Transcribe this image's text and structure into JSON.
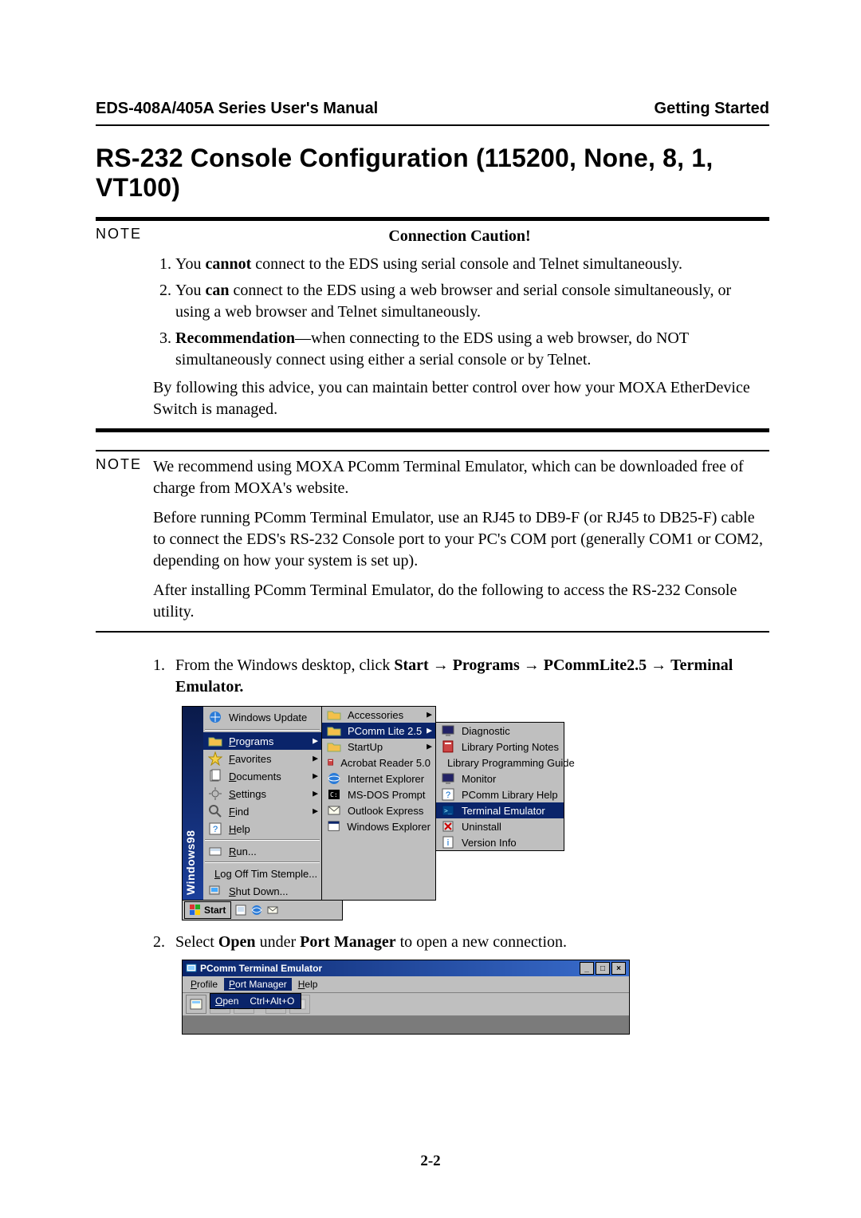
{
  "header": {
    "manual": "EDS-408A/405A Series User's Manual",
    "section": "Getting Started"
  },
  "title": "RS-232 Console Configuration (115200, None, 8, 1, VT100)",
  "note1": {
    "label": "NOTE",
    "caution_title": "Connection Caution!",
    "items": [
      {
        "pre": "You ",
        "b1": "cannot",
        "post": " connect to the EDS using serial console and Telnet simultaneously."
      },
      {
        "pre": "You ",
        "b1": "can",
        "post": " connect to the EDS using a web browser and serial console simultaneously, or using a web browser and Telnet simultaneously."
      },
      {
        "b1": "Recommendation",
        "dash": "—",
        "post": "when connecting to the EDS using a web browser, do NOT simultaneously connect using either a serial console or by Telnet."
      }
    ],
    "tail": "By following this advice, you can maintain better control over how your MOXA EtherDevice Switch is managed."
  },
  "note2": {
    "label": "NOTE",
    "paras": [
      "We recommend using MOXA PComm Terminal Emulator, which can be downloaded free of charge from MOXA's website.",
      "Before running PComm Terminal Emulator, use an RJ45 to DB9-F (or RJ45 to DB25-F) cable to connect the EDS's RS-232 Console port to your PC's COM port (generally COM1 or COM2, depending on how your system is set up).",
      "After installing PComm Terminal Emulator, do the following to access the RS-232 Console utility."
    ]
  },
  "step1": {
    "num": "1.",
    "pre": "From the Windows desktop, click ",
    "b1": "Start",
    "a1": " → ",
    "b2": "Programs",
    "a2": " → ",
    "b3": "PCommLite2.5",
    "a3": " → ",
    "b4": "Terminal Emulator."
  },
  "startmenu": {
    "brand_a": "Windows",
    "brand_b": "98",
    "items": [
      {
        "key": "wu",
        "label": "Windows Update",
        "arrow": false,
        "sel": false,
        "tall": true
      },
      {
        "key": "sep1",
        "label": "",
        "sep": true
      },
      {
        "key": "pr",
        "label": "Programs",
        "ul": "P",
        "arrow": true,
        "sel": true
      },
      {
        "key": "fa",
        "label": "Favorites",
        "ul": "F",
        "arrow": true,
        "sel": false
      },
      {
        "key": "do",
        "label": "Documents",
        "ul": "D",
        "arrow": true,
        "sel": false
      },
      {
        "key": "se",
        "label": "Settings",
        "ul": "S",
        "arrow": true,
        "sel": false
      },
      {
        "key": "fi",
        "label": "Find",
        "ul": "F",
        "arrow": true,
        "sel": false
      },
      {
        "key": "he",
        "label": "Help",
        "ul": "H",
        "arrow": false,
        "sel": false
      },
      {
        "key": "sep2",
        "label": "",
        "sep": true
      },
      {
        "key": "ru",
        "label": "Run...",
        "ul": "R",
        "arrow": false,
        "sel": false
      },
      {
        "key": "sep3",
        "label": "",
        "sep": true
      },
      {
        "key": "lo",
        "label": "Log Off Tim Stemple...",
        "ul": "L",
        "arrow": false,
        "sel": false
      },
      {
        "key": "sh",
        "label": "Shut Down...",
        "ul": "S",
        "arrow": false,
        "sel": false
      }
    ],
    "subA": [
      {
        "label": "Accessories",
        "arrow": true,
        "sel": false
      },
      {
        "label": "PComm Lite 2.5",
        "arrow": true,
        "sel": true
      },
      {
        "label": "StartUp",
        "arrow": true,
        "sel": false
      },
      {
        "label": "Acrobat Reader 5.0",
        "arrow": false,
        "sel": false
      },
      {
        "label": "Internet Explorer",
        "arrow": false,
        "sel": false
      },
      {
        "label": "MS-DOS Prompt",
        "arrow": false,
        "sel": false
      },
      {
        "label": "Outlook Express",
        "arrow": false,
        "sel": false
      },
      {
        "label": "Windows Explorer",
        "arrow": false,
        "sel": false
      }
    ],
    "subB": [
      {
        "label": "Diagnostic",
        "sel": false
      },
      {
        "label": "Library Porting Notes",
        "sel": false
      },
      {
        "label": "Library Programming Guide",
        "sel": false
      },
      {
        "label": "Monitor",
        "sel": false
      },
      {
        "label": "PComm Library Help",
        "sel": false
      },
      {
        "label": "Terminal Emulator",
        "sel": true
      },
      {
        "label": "Uninstall",
        "sel": false
      },
      {
        "label": "Version Info",
        "sel": false
      }
    ],
    "taskbar": {
      "start": "Start"
    }
  },
  "step2": {
    "num": "2.",
    "pre": "Select ",
    "b1": "Open",
    "mid": " under ",
    "b2": "Port Manager",
    "post": " to open a new connection."
  },
  "pcomm": {
    "title": "PComm Terminal Emulator",
    "menus": {
      "profile": "Profile",
      "portmgr": "Port Manager",
      "help": "Help"
    },
    "dropdown": {
      "open": "Open",
      "shortcut": "Ctrl+Alt+O"
    }
  },
  "page_number": "2-2"
}
